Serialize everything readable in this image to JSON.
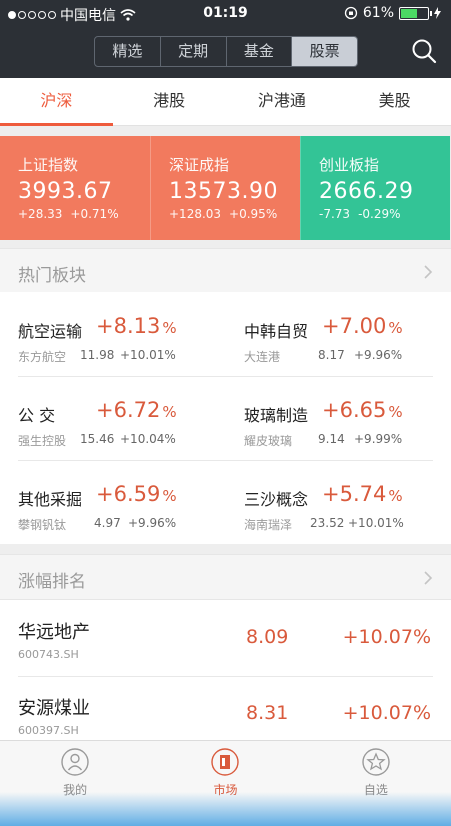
{
  "status_bar": {
    "carrier": "中国电信",
    "time": "01:19",
    "battery": "61%"
  },
  "segments": [
    {
      "label": "精选"
    },
    {
      "label": "定期"
    },
    {
      "label": "基金"
    },
    {
      "label": "股票"
    }
  ],
  "active_segment": "股票",
  "tabs": [
    {
      "label": "沪深"
    },
    {
      "label": "港股"
    },
    {
      "label": "沪港通"
    },
    {
      "label": "美股"
    }
  ],
  "indices": [
    {
      "name": "上证指数",
      "value": "3993.67",
      "change": "+28.33",
      "pct": "+0.71%"
    },
    {
      "name": "深证成指",
      "value": "13573.90",
      "change": "+128.03",
      "pct": "+0.95%"
    },
    {
      "name": "创业板指",
      "value": "2666.29",
      "change": "-7.73",
      "pct": "-0.29%"
    }
  ],
  "hot_sectors": {
    "title": "热门板块",
    "items": [
      {
        "name": "航空运输",
        "pct": "+8.13",
        "unit": "%",
        "stock": "东方航空",
        "price": "11.98",
        "change": "+10.01%"
      },
      {
        "name": "中韩自贸",
        "pct": "+7.00",
        "unit": "%",
        "stock": "大连港",
        "price": "8.17",
        "change": "+9.96%"
      },
      {
        "name": "公 交",
        "pct": "+6.72",
        "unit": "%",
        "stock": "强生控股",
        "price": "15.46",
        "change": "+10.04%"
      },
      {
        "name": "玻璃制造",
        "pct": "+6.65",
        "unit": "%",
        "stock": "耀皮玻璃",
        "price": "9.14",
        "change": "+9.99%"
      },
      {
        "name": "其他采掘",
        "pct": "+6.59",
        "unit": "%",
        "stock": "攀钢钒钛",
        "price": "4.97",
        "change": "+9.96%"
      },
      {
        "name": "三沙概念",
        "pct": "+5.74",
        "unit": "%",
        "stock": "海南瑞泽",
        "price": "23.52",
        "change": "+10.01%"
      }
    ]
  },
  "ranking": {
    "title": "涨幅排名",
    "rows": [
      {
        "name": "华远地产",
        "code": "600743.SH",
        "price": "8.09",
        "change": "+10.07%"
      },
      {
        "name": "安源煤业",
        "code": "600397.SH",
        "price": "8.31",
        "change": "+10.07%"
      }
    ]
  },
  "tab_bar": [
    {
      "label": "我的",
      "icon": "user-icon"
    },
    {
      "label": "市场",
      "icon": "market-icon"
    },
    {
      "label": "自选",
      "icon": "star-icon"
    }
  ],
  "colors": {
    "header_bg": "#2c3036",
    "accent": "#ee5b3c",
    "up_red": "#d95a3c",
    "index_red": "#f27a5e",
    "index_green": "#33c496"
  }
}
